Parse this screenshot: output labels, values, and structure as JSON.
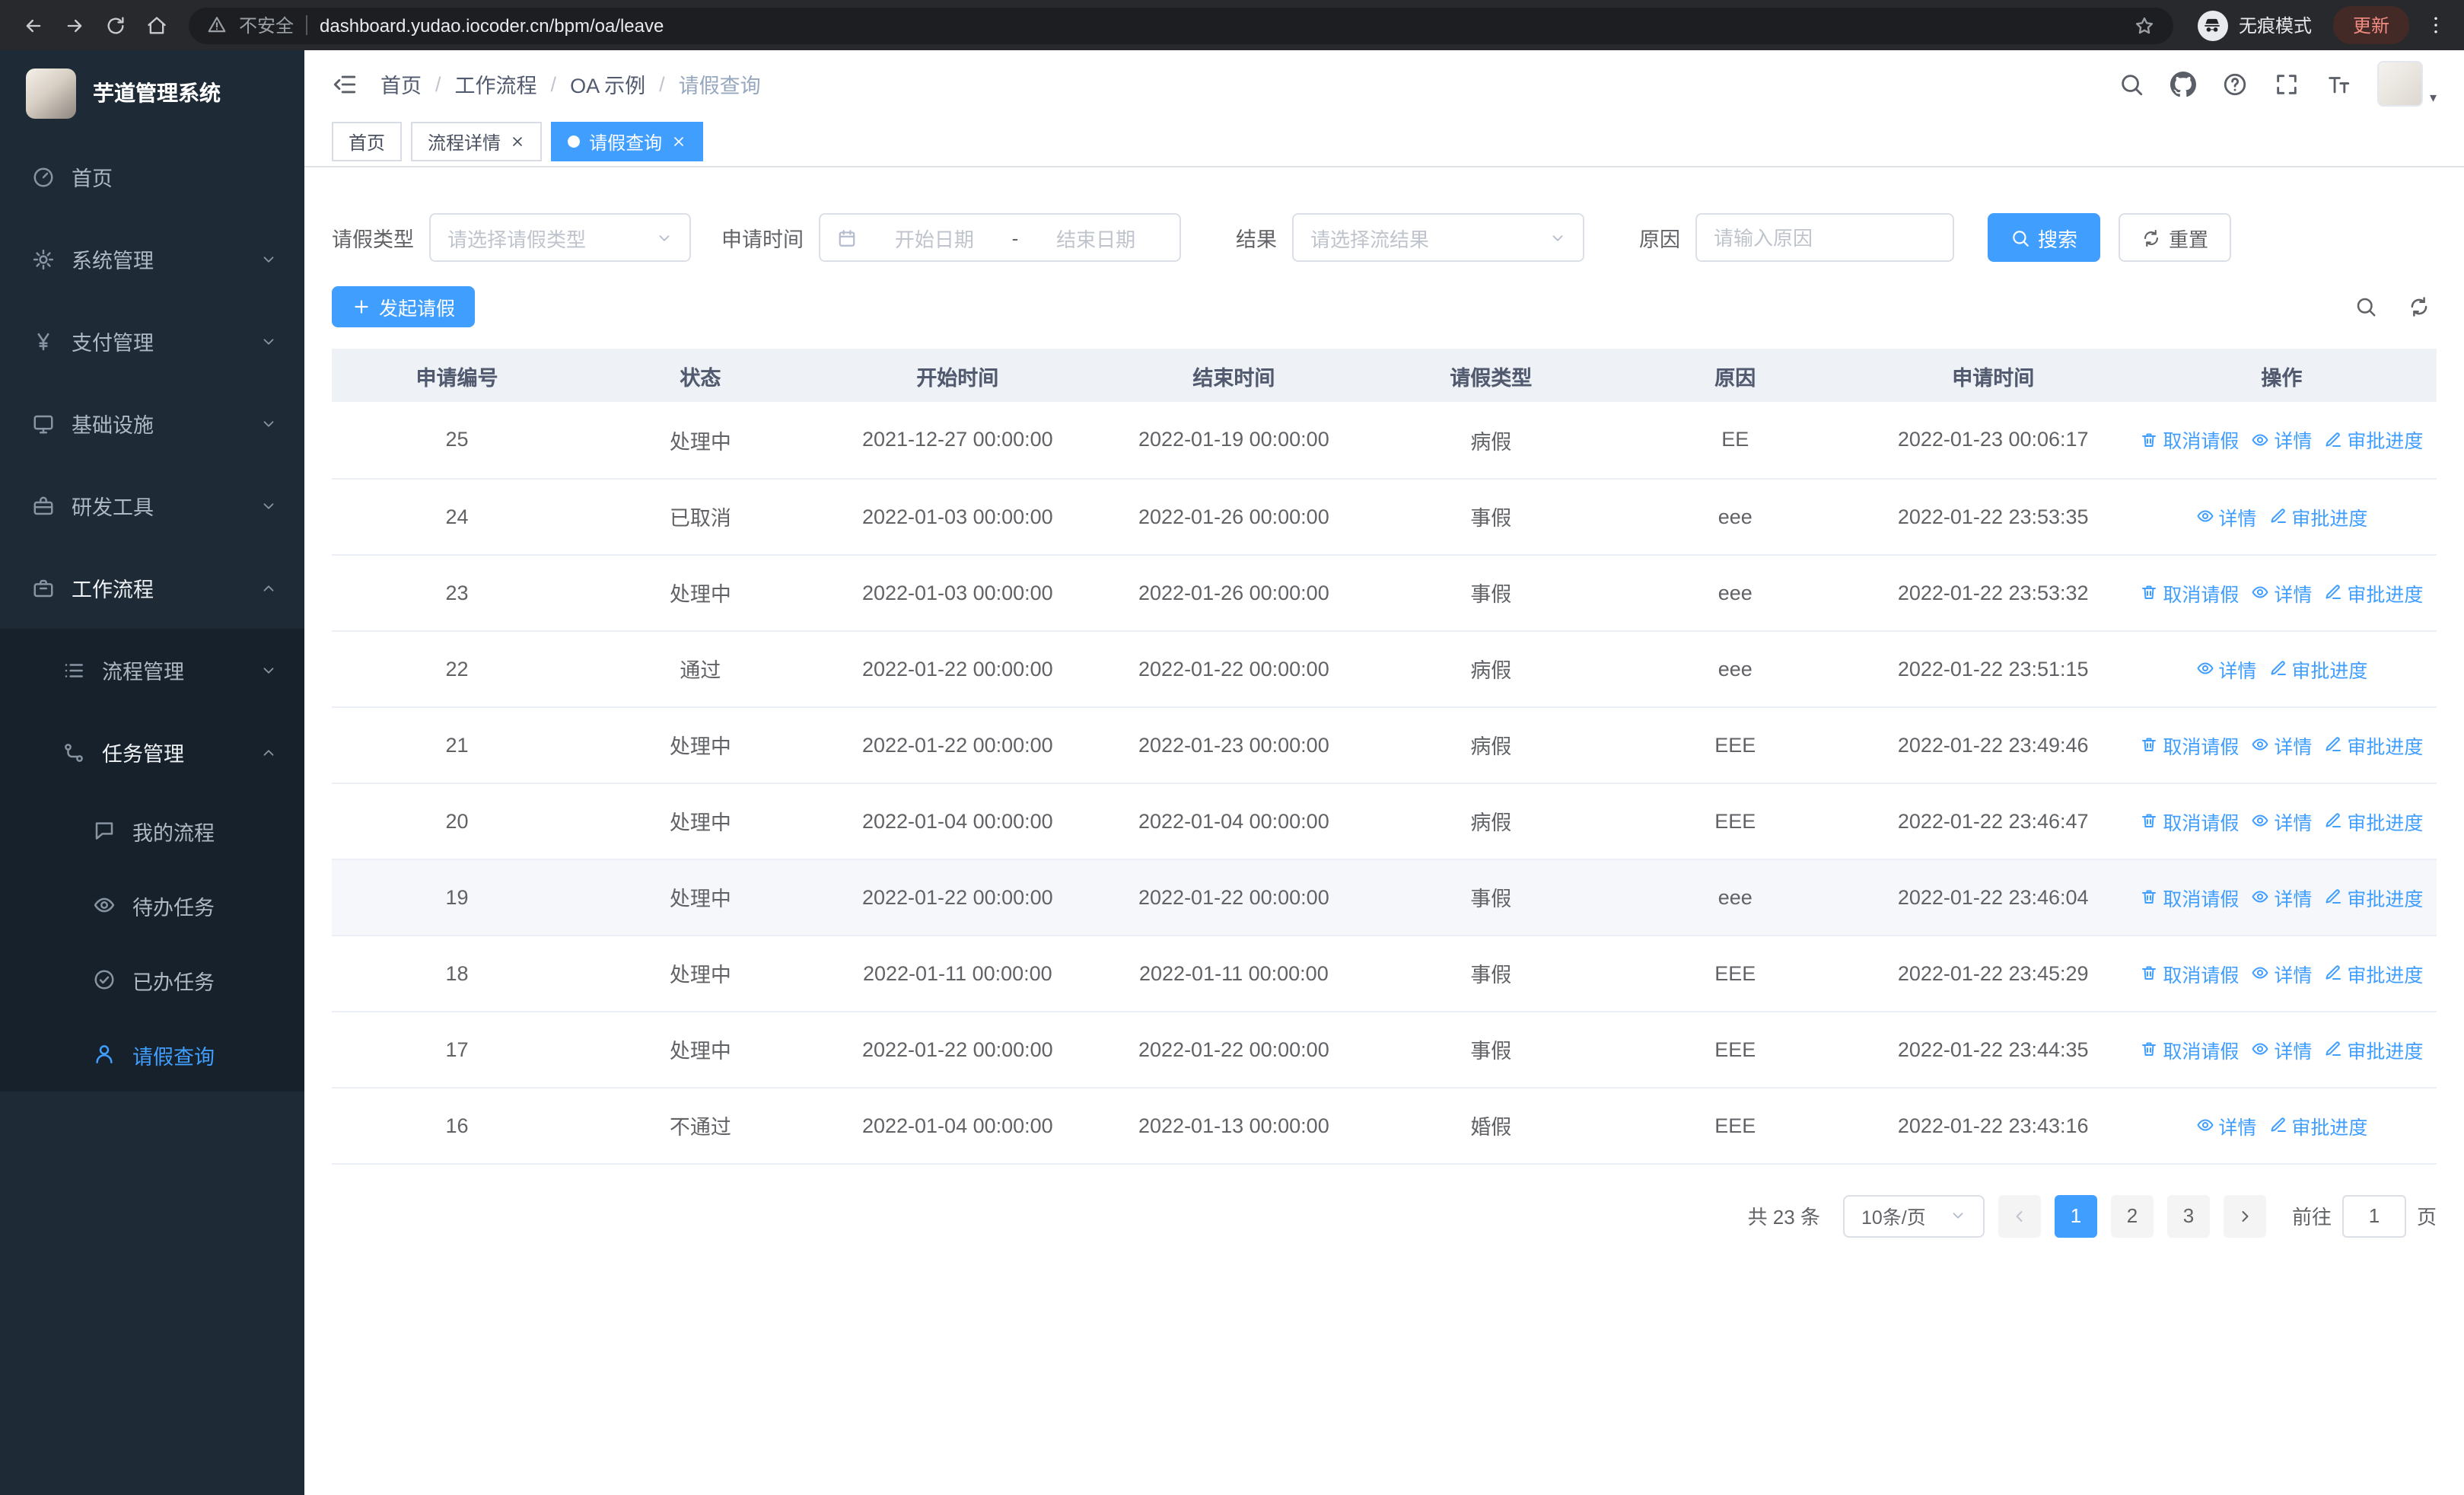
{
  "colors": {
    "primary": "#409eff",
    "link": "#409eff",
    "sidebar_bg": "#1e2a36",
    "sidebar_submenu_bg": "#17212b",
    "table_header_bg": "#eef1f6",
    "browser_bar_bg": "#28292c",
    "update_chip_text": "#f28b82"
  },
  "browser": {
    "security_label": "不安全",
    "url": "dashboard.yudao.iocoder.cn/bpm/oa/leave",
    "incognito_label": "无痕模式",
    "update_label": "更新"
  },
  "sidebar": {
    "logo_title": "芋道管理系统",
    "menu": [
      {
        "name": "home",
        "label": "首页",
        "icon": "dashboard",
        "level": 1
      },
      {
        "name": "system-management",
        "label": "系统管理",
        "icon": "gear",
        "level": 1,
        "chevron": "down"
      },
      {
        "name": "payment-management",
        "label": "支付管理",
        "icon": "yen",
        "level": 1,
        "chevron": "down"
      },
      {
        "name": "infrastructure",
        "label": "基础设施",
        "icon": "monitor",
        "level": 1,
        "chevron": "down"
      },
      {
        "name": "dev-tools",
        "label": "研发工具",
        "icon": "toolbox",
        "level": 1,
        "chevron": "down"
      },
      {
        "name": "workflow",
        "label": "工作流程",
        "icon": "briefcase",
        "level": 1,
        "chevron": "up",
        "active_parent": true
      },
      {
        "name": "process-management",
        "label": "流程管理",
        "icon": "list",
        "level": 2,
        "chevron": "down"
      },
      {
        "name": "task-management",
        "label": "任务管理",
        "icon": "branch",
        "level": 2,
        "chevron": "up",
        "active_parent": true
      },
      {
        "name": "my-process",
        "label": "我的流程",
        "icon": "chat",
        "level": 3
      },
      {
        "name": "todo-task",
        "label": "待办任务",
        "icon": "eye",
        "level": 3
      },
      {
        "name": "done-task",
        "label": "已办任务",
        "icon": "check-circle",
        "level": 3
      },
      {
        "name": "leave-query",
        "label": "请假查询",
        "icon": "user",
        "level": 3,
        "active": true
      }
    ]
  },
  "header": {
    "breadcrumb": [
      "首页",
      "工作流程",
      "OA 示例",
      "请假查询"
    ],
    "icons": [
      "search",
      "github",
      "question",
      "fullscreen",
      "font-size"
    ]
  },
  "tabs": [
    {
      "label": "首页",
      "closable": false,
      "active": false
    },
    {
      "label": "流程详情",
      "closable": true,
      "active": false
    },
    {
      "label": "请假查询",
      "closable": true,
      "active": true
    }
  ],
  "filters": {
    "leave_type_label": "请假类型",
    "leave_type_placeholder": "请选择请假类型",
    "apply_time_label": "申请时间",
    "start_date_placeholder": "开始日期",
    "date_separator": "-",
    "end_date_placeholder": "结束日期",
    "result_label": "结果",
    "result_placeholder": "请选择流结果",
    "reason_label": "原因",
    "reason_placeholder": "请输入原因",
    "search_label": "搜索",
    "reset_label": "重置"
  },
  "toolbar": {
    "create_label": "发起请假"
  },
  "table": {
    "columns": [
      "申请编号",
      "状态",
      "开始时间",
      "结束时间",
      "请假类型",
      "原因",
      "申请时间",
      "操作"
    ],
    "actions": {
      "cancel": "取消请假",
      "detail": "详情",
      "progress": "审批进度"
    },
    "action_icons": {
      "cancel": "trash",
      "detail": "eye",
      "progress": "edit"
    },
    "rows": [
      {
        "id": "25",
        "status": "处理中",
        "start": "2021-12-27 00:00:00",
        "end": "2022-01-19 00:00:00",
        "type": "病假",
        "reason": "EE",
        "applied": "2022-01-23 00:06:17",
        "can_cancel": true
      },
      {
        "id": "24",
        "status": "已取消",
        "start": "2022-01-03 00:00:00",
        "end": "2022-01-26 00:00:00",
        "type": "事假",
        "reason": "eee",
        "applied": "2022-01-22 23:53:35",
        "can_cancel": false
      },
      {
        "id": "23",
        "status": "处理中",
        "start": "2022-01-03 00:00:00",
        "end": "2022-01-26 00:00:00",
        "type": "事假",
        "reason": "eee",
        "applied": "2022-01-22 23:53:32",
        "can_cancel": true
      },
      {
        "id": "22",
        "status": "通过",
        "start": "2022-01-22 00:00:00",
        "end": "2022-01-22 00:00:00",
        "type": "病假",
        "reason": "eee",
        "applied": "2022-01-22 23:51:15",
        "can_cancel": false
      },
      {
        "id": "21",
        "status": "处理中",
        "start": "2022-01-22 00:00:00",
        "end": "2022-01-23 00:00:00",
        "type": "病假",
        "reason": "EEE",
        "applied": "2022-01-22 23:49:46",
        "can_cancel": true
      },
      {
        "id": "20",
        "status": "处理中",
        "start": "2022-01-04 00:00:00",
        "end": "2022-01-04 00:00:00",
        "type": "病假",
        "reason": "EEE",
        "applied": "2022-01-22 23:46:47",
        "can_cancel": true
      },
      {
        "id": "19",
        "status": "处理中",
        "start": "2022-01-22 00:00:00",
        "end": "2022-01-22 00:00:00",
        "type": "事假",
        "reason": "eee",
        "applied": "2022-01-22 23:46:04",
        "can_cancel": true,
        "hover": true
      },
      {
        "id": "18",
        "status": "处理中",
        "start": "2022-01-11 00:00:00",
        "end": "2022-01-11 00:00:00",
        "type": "事假",
        "reason": "EEE",
        "applied": "2022-01-22 23:45:29",
        "can_cancel": true
      },
      {
        "id": "17",
        "status": "处理中",
        "start": "2022-01-22 00:00:00",
        "end": "2022-01-22 00:00:00",
        "type": "事假",
        "reason": "EEE",
        "applied": "2022-01-22 23:44:35",
        "can_cancel": true
      },
      {
        "id": "16",
        "status": "不通过",
        "start": "2022-01-04 00:00:00",
        "end": "2022-01-13 00:00:00",
        "type": "婚假",
        "reason": "EEE",
        "applied": "2022-01-22 23:43:16",
        "can_cancel": false
      }
    ]
  },
  "pagination": {
    "total_label": "共 23 条",
    "page_size": "10条/页",
    "pages": [
      "1",
      "2",
      "3"
    ],
    "active_page": "1",
    "goto_label": "前往",
    "goto_value": "1",
    "page_unit": "页"
  },
  "icons": {
    "back": "arrow-left",
    "forward": "arrow-right",
    "reload": "circular-arrow",
    "home": "house",
    "warning": "triangle-exclamation",
    "star": "star-outline",
    "incognito": "spy-hat-glasses",
    "menu-dots": "vertical-ellipsis",
    "fold": "indent-lines",
    "search": "magnifier",
    "github": "octocat",
    "question": "question-circle",
    "fullscreen": "expand-corners",
    "font-size": "double-T",
    "chevron-down": "angle-down",
    "chevron-up": "angle-up",
    "chevron-left": "angle-left",
    "chevron-right": "angle-right",
    "calendar": "calendar-grid",
    "plus": "plus",
    "refresh": "double-circular-arrow",
    "trash": "trash-can",
    "eye": "eye",
    "edit": "pen",
    "close": "x",
    "user": "person",
    "dashboard": "gauge",
    "gear": "cog",
    "yen": "yen-sign",
    "monitor": "screen",
    "toolbox": "toolbox",
    "briefcase": "briefcase",
    "list": "list-lines",
    "branch": "nodes-link",
    "chat": "speech-bubble",
    "check-circle": "check-circle"
  }
}
